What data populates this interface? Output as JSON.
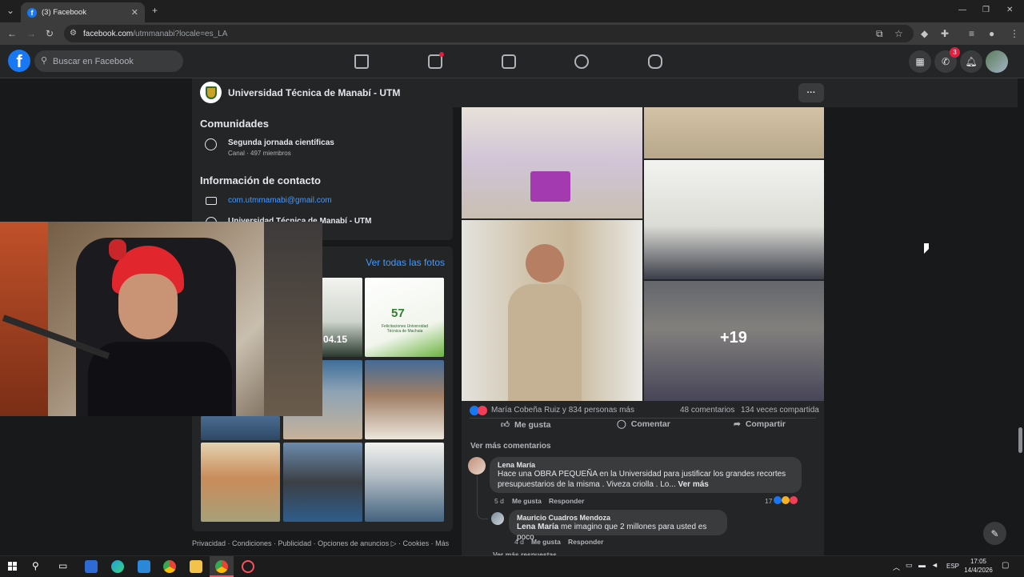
{
  "browser": {
    "tab_title": "(3) Facebook",
    "url_host": "facebook.com",
    "url_path": "/utmmanabi?locale=es_LA"
  },
  "header": {
    "search_placeholder": "Buscar en Facebook",
    "messenger_badge": "3"
  },
  "page": {
    "name": "Universidad Técnica de Manabí - UTM",
    "more_label": "···"
  },
  "communities": {
    "title": "Comunidades",
    "item_name": "Segunda jornada científicas",
    "item_meta": "Canal · 497 miembros"
  },
  "contact": {
    "title": "Información de contacto",
    "email": "com.utmmamabi@gmail.com",
    "name": "Universidad Técnica de Manabí - UTM"
  },
  "photos": {
    "see_all": "Ver todas las fotos",
    "thumb_2_text": "04.15",
    "thumb_3_big": "57",
    "thumb_3_text": "Felicitaciones Universidad Técnica de Machala"
  },
  "post": {
    "more_count": "+19",
    "reactions_text": "María Cobeña Ruiz y 834 personas más",
    "comments_count": "48 comentarios",
    "shares_count": "134 veces compartida",
    "like_label": "Me gusta",
    "comment_label": "Comentar",
    "share_label": "Compartir",
    "see_more_comments": "Ver más comentarios",
    "see_more_replies": "Ver más respuestas"
  },
  "comments": [
    {
      "name": "Lena María",
      "text": "Hace una OBRA PEQUEÑA en la Universidad para justificar los grandes recortes presupuestarios de la misma . Viveza criolla . Lo...",
      "see_more": "Ver más",
      "time": "5 d",
      "like": "Me gusta",
      "reply": "Responder",
      "reaction_count": "17"
    },
    {
      "name": "Mauricio Cuadros Mendoza",
      "mention": "Lena María",
      "text": "me imagino que 2 millones para usted es poco",
      "time": "4 d",
      "like": "Me gusta",
      "reply": "Responder"
    }
  ],
  "footer": {
    "links": "Privacidad · Condiciones · Publicidad · Opciones de anuncios ▷ · Cookies · Más"
  },
  "taskbar": {
    "language": "ESP",
    "time": "17:05",
    "date": "14/4/2026"
  },
  "colors": {
    "fb_blue": "#1877f2",
    "link_blue": "#4599ff",
    "surface": "#242526",
    "background": "#18191a"
  }
}
